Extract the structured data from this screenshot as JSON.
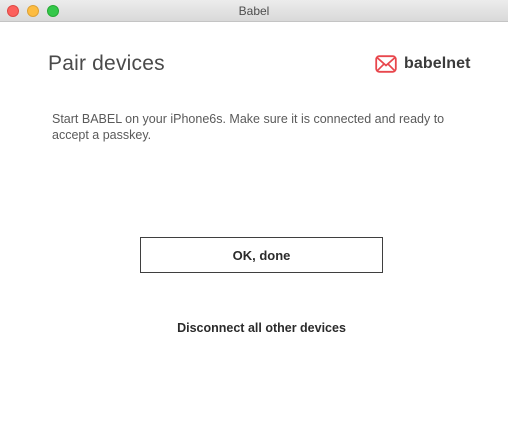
{
  "window": {
    "title": "Babel"
  },
  "header": {
    "title": "Pair devices",
    "brand_name": "babelnet",
    "brand_color": "#e8474d",
    "brand_icon": "envelope-icon"
  },
  "content": {
    "instructions": "Start BABEL on your iPhone6s. Make sure it is connected and ready to accept a passkey."
  },
  "actions": {
    "ok_label": "OK, done",
    "disconnect_label": "Disconnect all other devices"
  }
}
